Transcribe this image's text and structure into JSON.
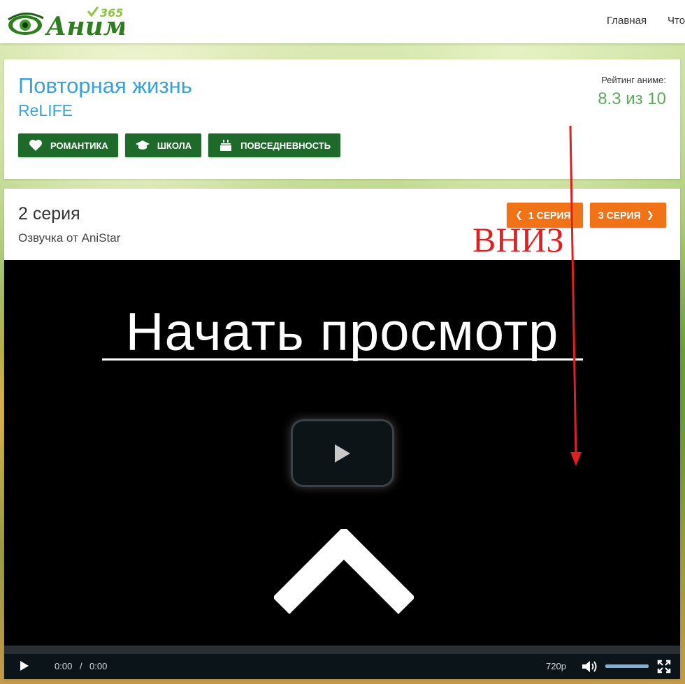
{
  "header": {
    "logo_text": "Аниме",
    "logo_superscript": "365",
    "nav": [
      "Главная",
      "Что"
    ]
  },
  "anime": {
    "title_ru": "Повторная жизнь",
    "title_en": "ReLIFE",
    "rating_label": "Рейтинг аниме:",
    "rating_value": "8.3 из 10",
    "genres": [
      {
        "label": "РОМАНТИКА",
        "icon": "heart-icon"
      },
      {
        "label": "ШКОЛА",
        "icon": "graduation-cap-icon"
      },
      {
        "label": "ПОВСЕДНЕВНОСТЬ",
        "icon": "cake-icon"
      }
    ]
  },
  "episode": {
    "title": "2 серия",
    "voice": "Озвучка от AniStar",
    "prev_label": "1 СЕРИЯ",
    "next_label": "3 СЕРИЯ"
  },
  "player": {
    "overlay_text": "Начать просмотр",
    "current_time": "0:00",
    "separator": "/",
    "duration": "0:00",
    "quality": "720p",
    "volume": 1.0
  },
  "annotation": {
    "text": "ВНИЗ"
  },
  "colors": {
    "title_blue": "#3aa0d6",
    "rating_green": "#5daa5d",
    "genre_green": "#1e6a2a",
    "episode_orange": "#f07318",
    "annotation_red": "#e02020"
  }
}
